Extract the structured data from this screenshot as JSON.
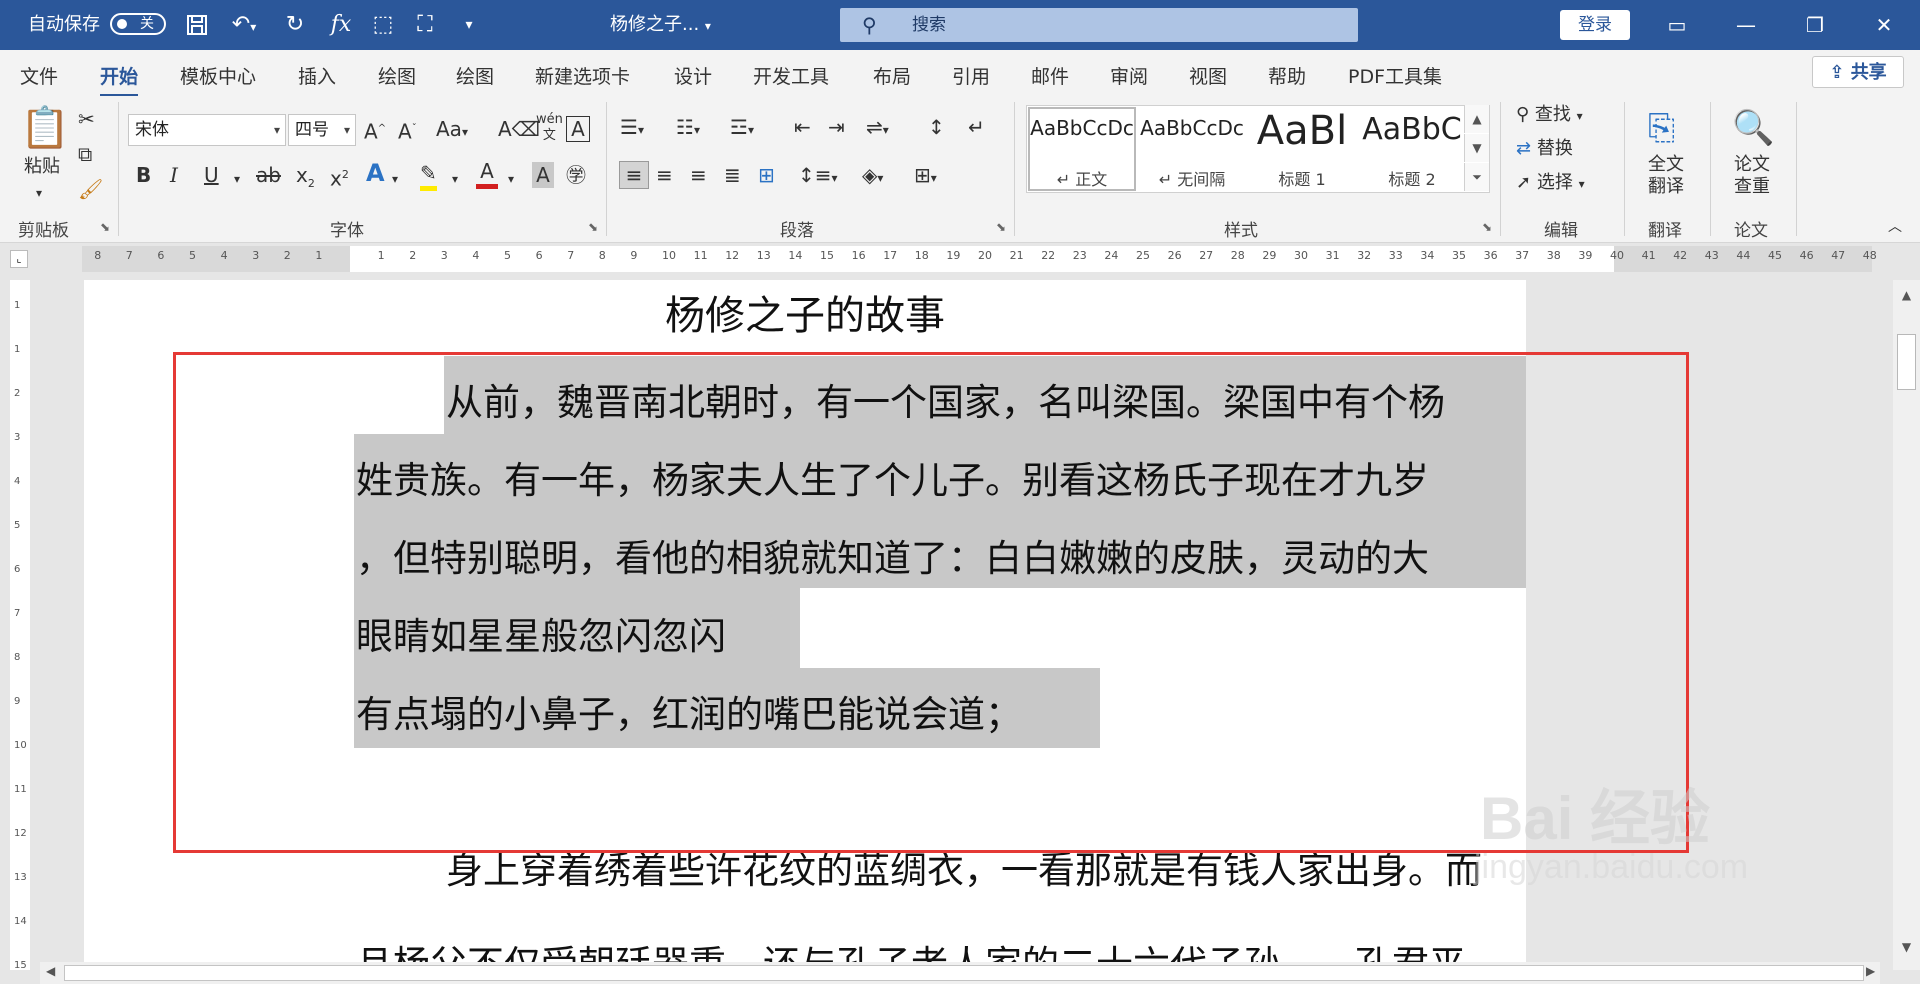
{
  "titlebar": {
    "autosave_label": "自动保存",
    "autosave_state": "关",
    "doc_title": "杨修之子...",
    "search_placeholder": "搜索",
    "login": "登录",
    "qat_icons": [
      "save-icon",
      "undo-icon",
      "redo-icon",
      "fx-icon",
      "touch-mode-icon",
      "tree-icon",
      "customize-qat-icon"
    ]
  },
  "tabs": [
    "文件",
    "开始",
    "模板中心",
    "插入",
    "绘图",
    "绘图",
    "新建选项卡",
    "设计",
    "开发工具",
    "布局",
    "引用",
    "邮件",
    "审阅",
    "视图",
    "帮助",
    "PDF工具集"
  ],
  "active_tab": "开始",
  "share": "共享",
  "ribbon": {
    "clipboard": {
      "paste": "粘贴",
      "label": "剪贴板"
    },
    "font": {
      "name": "宋体",
      "size": "四号",
      "label": "字体"
    },
    "paragraph": {
      "label": "段落"
    },
    "styles": {
      "label": "样式",
      "items": [
        {
          "sample": "AaBbCcDc",
          "name": "↵ 正文"
        },
        {
          "sample": "AaBbCcDc",
          "name": "↵ 无间隔"
        },
        {
          "sample": "AaBl",
          "name": "标题 1"
        },
        {
          "sample": "AaBbC",
          "name": "标题 2"
        }
      ]
    },
    "editing": {
      "find": "查找",
      "replace": "替换",
      "select": "选择",
      "label": "编辑"
    },
    "translate": {
      "button": "全文翻译",
      "button_l1": "全文",
      "button_l2": "翻译",
      "label": "翻译"
    },
    "paper": {
      "button_l1": "论文",
      "button_l2": "查重",
      "label": "论文"
    }
  },
  "ruler": {
    "left_numbers": [
      "8",
      "7",
      "6",
      "5",
      "4",
      "3",
      "2",
      "1"
    ],
    "right_numbers": [
      "1",
      "2",
      "3",
      "4",
      "5",
      "6",
      "7",
      "8",
      "9",
      "10",
      "11",
      "12",
      "13",
      "14",
      "15",
      "16",
      "17",
      "18",
      "19",
      "20",
      "21",
      "22",
      "23",
      "24",
      "25",
      "26",
      "27",
      "28",
      "29",
      "30",
      "31",
      "32",
      "33",
      "34",
      "35",
      "36",
      "37",
      "38",
      "39",
      "40",
      "41",
      "42",
      "43",
      "44",
      "45",
      "46",
      "47",
      "48"
    ],
    "vertical_numbers": [
      "1",
      "1",
      "2",
      "3",
      "4",
      "5",
      "6",
      "7",
      "8",
      "9",
      "10",
      "11",
      "12",
      "13",
      "14",
      "15"
    ]
  },
  "document": {
    "title": "杨修之子的故事",
    "lines": [
      "从前，魏晋南北朝时，有一个国家，名叫梁国。梁国中有个杨",
      "姓贵族。有一年，杨家夫人生了个儿子。别看这杨氏子现在才九岁",
      "，但特别聪明，看他的相貌就知道了：白白嫩嫩的皮肤，灵动的大",
      "眼睛如星星般忽闪忽闪",
      "有点塌的小鼻子，红润的嘴巴能说会道；",
      "身上穿着绣着些许花纹的蓝绸衣，一看那就是有钱人家出身。而",
      "且杨父不仅受朝廷器重，还与孔子老人家的二十六代子孙——孔君平"
    ]
  },
  "watermark": {
    "brand": "Bai 经验",
    "url": "jingyan.baidu.com"
  }
}
